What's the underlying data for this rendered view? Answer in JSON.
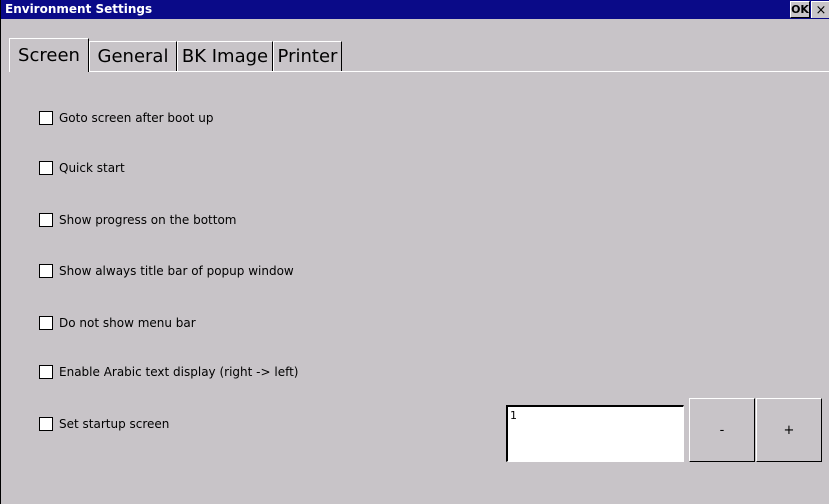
{
  "window": {
    "title": "Environment Settings",
    "ok_label": "OK",
    "close_label": "×"
  },
  "tabs": [
    {
      "label": "Screen",
      "active": true
    },
    {
      "label": "General",
      "active": false
    },
    {
      "label": "BK Image",
      "active": false
    },
    {
      "label": "Printer",
      "active": false
    }
  ],
  "options": [
    {
      "label": "Goto screen after boot up",
      "checked": false
    },
    {
      "label": "Quick start",
      "checked": false
    },
    {
      "label": "Show progress on the bottom",
      "checked": false
    },
    {
      "label": "Show always title bar of popup window",
      "checked": false
    },
    {
      "label": "Do not show menu bar",
      "checked": false
    },
    {
      "label": "Enable Arabic text display (right -> left)",
      "checked": false
    },
    {
      "label": "Set startup screen",
      "checked": false
    }
  ],
  "startup": {
    "value": "1",
    "minus_label": "-",
    "plus_label": "+"
  }
}
